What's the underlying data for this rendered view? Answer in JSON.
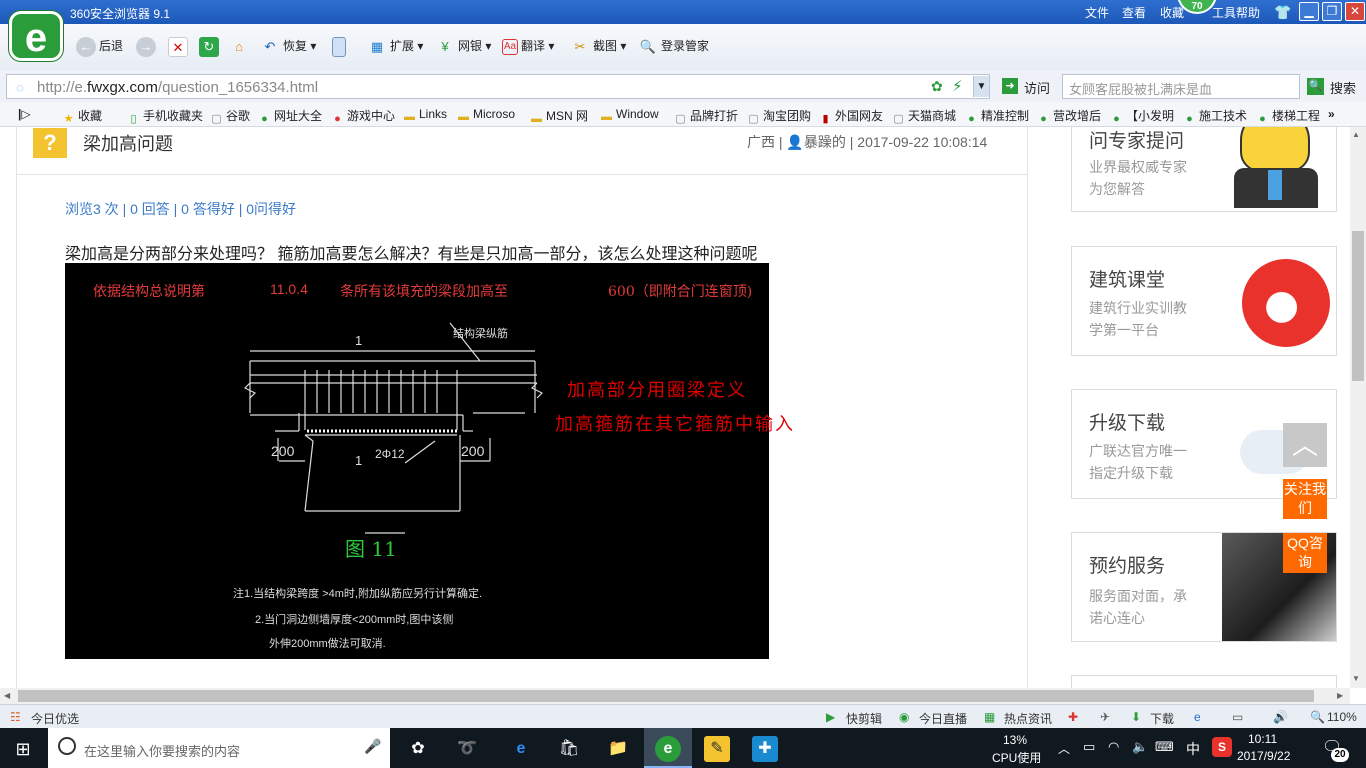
{
  "window": {
    "title": "360安全浏览器 9.1",
    "menus": [
      "文件",
      "查看",
      "收藏",
      "工具",
      "帮助"
    ],
    "badge": "70"
  },
  "toolbar": {
    "back": "后退",
    "restore": "恢复",
    "extend": "扩展",
    "bank": "网银",
    "translate": "翻译",
    "screenshot": "截图",
    "login": "登录管家"
  },
  "address": {
    "url_prefix": "http://e.",
    "url_domain": "fwxgx.com",
    "url_path": "/question_1656334.html",
    "visit": "访问",
    "search_placeholder": "女顾客屁股被扎满床是血",
    "search_button": "搜索"
  },
  "favorites": [
    "收藏",
    "手机收藏夹",
    "谷歌",
    "网址大全",
    "游戏中心",
    "Links",
    "Microso",
    "MSN 网",
    "Window",
    "品牌打折",
    "淘宝团购",
    "外国网友",
    "天猫商城",
    "精准控制",
    "营改增后",
    "【小发明",
    "施工技术",
    "楼梯工程"
  ],
  "question": {
    "title": "梁加高问题",
    "region": "广西",
    "author": "暴躁的",
    "date": "2017-09-22 10:08:14",
    "stats": "浏览3 次 | 0 回答 | 0 答得好 | 0问得好",
    "body": "梁加高是分两部分来处理吗？ 箍筋加高要怎么解决？有些是只加高一部分，该怎么处理这种问题呢",
    "cad": {
      "header1": "依据结构总说明第",
      "header2": "11.0.4",
      "header3": "条所有该填充的梁段加高至",
      "header4": "600（即附合门连窗顶)",
      "rebar_label": "结构梁纵筋",
      "dim_left": "200",
      "dim_right": "200",
      "mark1": "1",
      "mark2": "1",
      "bar": "2Φ12",
      "fig": "图 11",
      "note1": "注1.当结构梁跨度 >4m时,附加纵筋应另行计算确定.",
      "note2": "2.当门洞边侧墙厚度<200mm时,图中该侧",
      "note3": "外伸200mm做法可取消."
    },
    "annot1": "加高部分用圈梁定义",
    "annot2": "加高箍筋在其它箍筋中输入"
  },
  "sidebar": [
    {
      "title": "问专家提问",
      "sub1": "业界最权威专家",
      "sub2": "为您解答"
    },
    {
      "title": "建筑课堂",
      "sub1": "建筑行业实训教",
      "sub2": "学第一平台"
    },
    {
      "title": "升级下载",
      "sub1": "广联达官方唯一",
      "sub2": "指定升级下载"
    },
    {
      "title": "预约服务",
      "sub1": "服务面对面，承",
      "sub2": "诺心连心"
    }
  ],
  "float": {
    "follow": "关注我们",
    "qq": "QQ咨询"
  },
  "statusbar": {
    "left": "今日优选",
    "items": [
      "快剪辑",
      "今日直播",
      "热点资讯",
      "下载"
    ],
    "zoom": "110%"
  },
  "taskbar": {
    "search": "在这里输入你要搜索的内容",
    "cpu_pct": "13%",
    "cpu_label": "CPU使用",
    "ime": "中",
    "time": "10:11",
    "date": "2017/9/22",
    "notif": "20"
  },
  "colors": {
    "accent": "#2a9d3a",
    "red_annot": "#e00000",
    "float_orange": "#ff6a00"
  }
}
